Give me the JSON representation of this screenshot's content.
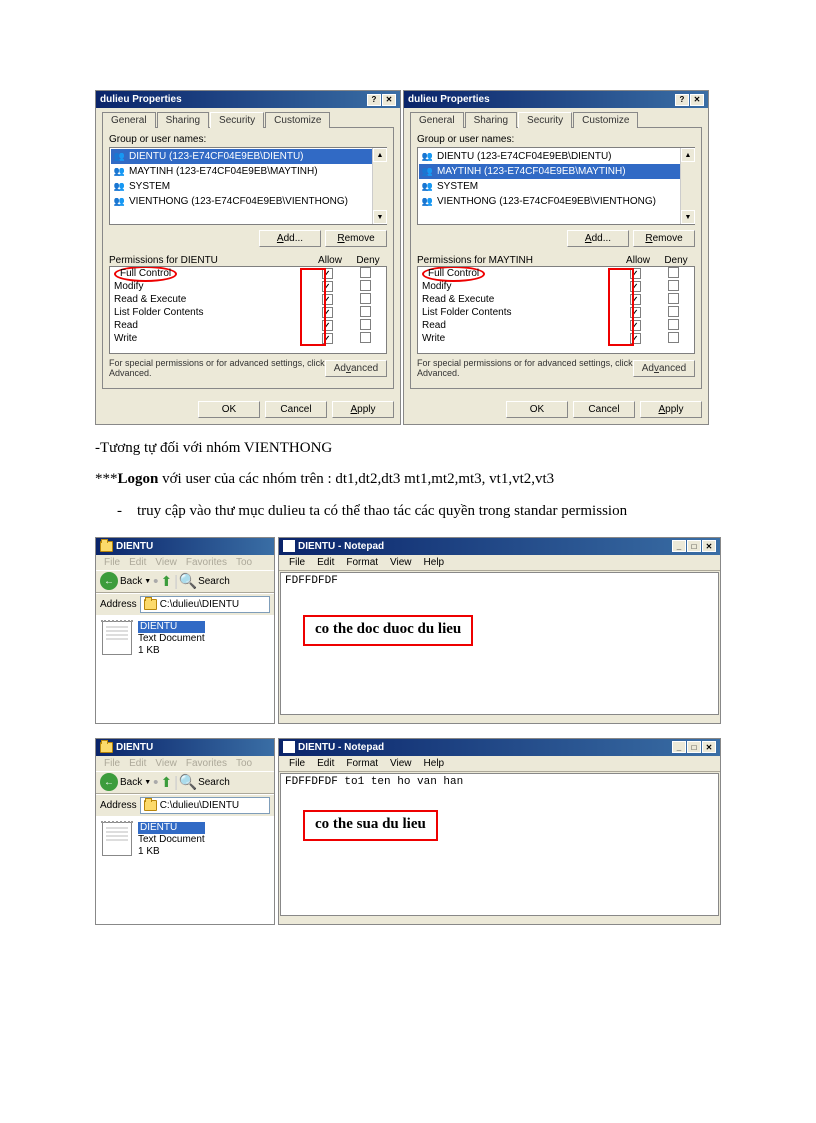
{
  "dialog1": {
    "title": "dulieu Properties",
    "tabs": [
      "General",
      "Sharing",
      "Security",
      "Customize"
    ],
    "activeTab": "Security",
    "groupLabel": "Group or user names:",
    "users": [
      "DIENTU (123-E74CF04E9EB\\DIENTU)",
      "MAYTINH (123-E74CF04E9EB\\MAYTINH)",
      "SYSTEM",
      "VIENTHONG (123-E74CF04E9EB\\VIENTHONG)"
    ],
    "selectedUser": 0,
    "addBtn": "Add...",
    "removeBtn": "Remove",
    "permLabel": "Permissions for DIENTU",
    "allowLabel": "Allow",
    "denyLabel": "Deny",
    "perms": [
      {
        "name": "Full Control",
        "allow": true,
        "deny": false,
        "circled": true
      },
      {
        "name": "Modify",
        "allow": true,
        "deny": false
      },
      {
        "name": "Read & Execute",
        "allow": true,
        "deny": false
      },
      {
        "name": "List Folder Contents",
        "allow": true,
        "deny": false
      },
      {
        "name": "Read",
        "allow": true,
        "deny": false
      },
      {
        "name": "Write",
        "allow": true,
        "deny": false
      }
    ],
    "advNote": "For special permissions or for advanced settings, click Advanced.",
    "advBtn": "Advanced",
    "okBtn": "OK",
    "cancelBtn": "Cancel",
    "applyBtn": "Apply"
  },
  "dialog2": {
    "title": "dulieu Properties",
    "tabs": [
      "General",
      "Sharing",
      "Security",
      "Customize"
    ],
    "activeTab": "Security",
    "groupLabel": "Group or user names:",
    "users": [
      "DIENTU (123-E74CF04E9EB\\DIENTU)",
      "MAYTINH (123-E74CF04E9EB\\MAYTINH)",
      "SYSTEM",
      "VIENTHONG (123-E74CF04E9EB\\VIENTHONG)"
    ],
    "selectedUser": 1,
    "addBtn": "Add...",
    "removeBtn": "Remove",
    "permLabel": "Permissions for MAYTINH",
    "allowLabel": "Allow",
    "denyLabel": "Deny",
    "perms": [
      {
        "name": "Full Control",
        "allow": true,
        "deny": false,
        "circled": true
      },
      {
        "name": "Modify",
        "allow": true,
        "deny": false
      },
      {
        "name": "Read & Execute",
        "allow": true,
        "deny": false
      },
      {
        "name": "List Folder Contents",
        "allow": true,
        "deny": false
      },
      {
        "name": "Read",
        "allow": true,
        "deny": false
      },
      {
        "name": "Write",
        "allow": true,
        "deny": false
      }
    ],
    "advNote": "For special permissions or for advanced settings, click Advanced.",
    "advBtn": "Advanced",
    "okBtn": "OK",
    "cancelBtn": "Cancel",
    "applyBtn": "Apply"
  },
  "text1": "-Tương tự đối với nhóm   VIENTHONG",
  "text2a": "***",
  "text2b": "Logon",
  "text2c": " với user của các nhóm trên  :   dt1,dt2,dt3   mt1,mt2,mt3, vt1,vt2,vt3",
  "bullet1a": "truy cập vào thư mục dulieu  ta có thể thao tác các quyền  trong ",
  "bullet1b": "standar permission",
  "explorer1": {
    "title": "DIENTU",
    "menu": [
      "File",
      "Edit",
      "View",
      "Favorites",
      "Too"
    ],
    "back": "Back",
    "search": "Search",
    "addrLabel": "Address",
    "addrPath": "C:\\dulieu\\DIENTU",
    "fileName": "DIENTU",
    "fileType": "Text Document",
    "fileSize": "1 KB"
  },
  "notepad1": {
    "title": "DIENTU - Notepad",
    "menu": [
      "File",
      "Edit",
      "Format",
      "View",
      "Help"
    ],
    "content": "FDFFDFDF",
    "annotation": "co the doc duoc du lieu"
  },
  "explorer2": {
    "title": "DIENTU",
    "menu": [
      "File",
      "Edit",
      "View",
      "Favorites",
      "Too"
    ],
    "back": "Back",
    "search": "Search",
    "addrLabel": "Address",
    "addrPath": "C:\\dulieu\\DIENTU",
    "fileName": "DIENTU",
    "fileType": "Text Document",
    "fileSize": "1 KB"
  },
  "notepad2": {
    "title": "DIENTU - Notepad",
    "menu": [
      "File",
      "Edit",
      "Format",
      "View",
      "Help"
    ],
    "content": "FDFFDFDF to1 ten ho van han",
    "annotation": "co the sua du lieu"
  }
}
